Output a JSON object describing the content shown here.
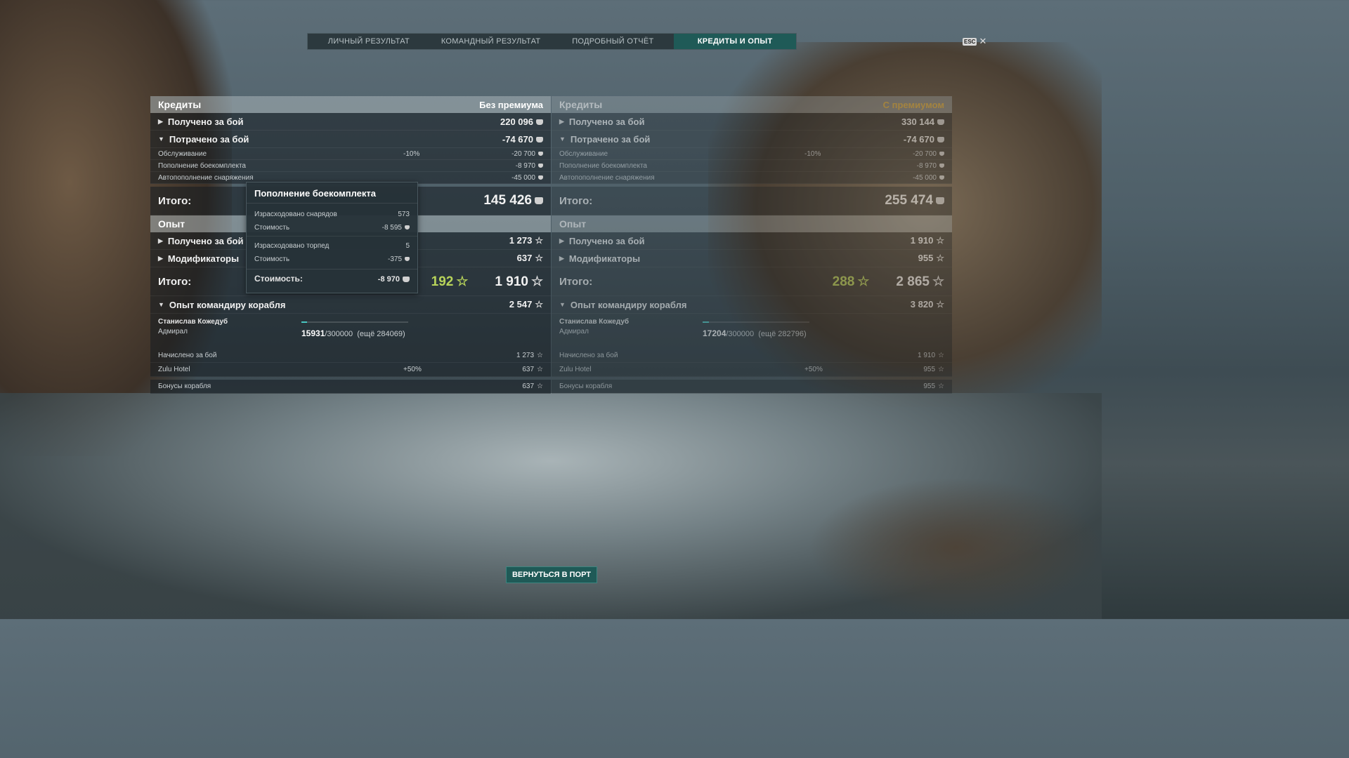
{
  "tabs": [
    "ЛИЧНЫЙ РЕЗУЛЬТАТ",
    "КОМАНДНЫЙ РЕЗУЛЬТАТ",
    "ПОДРОБНЫЙ ОТЧЁТ",
    "КРЕДИТЫ И ОПЫТ"
  ],
  "active_tab": "КРЕДИТЫ И ОПЫТ",
  "esc": {
    "key": "ESC",
    "close": "✕"
  },
  "left": {
    "credits_title": "Кредиты",
    "credits_sub": "Без премиума",
    "earned_label": "Получено за бой",
    "earned_value": "220 096",
    "spent_label": "Потрачено за бой",
    "spent_value": "-74 670",
    "service_label": "Обслуживание",
    "service_pct": "-10%",
    "service_value": "-20 700",
    "ammo_label": "Пополнение боекомплекта",
    "ammo_value": "-8 970",
    "auto_label": "Автопополнение снаряжения",
    "auto_value": "-45 000",
    "total_label": "Итого:",
    "total_value": "145 426",
    "xp_title": "Опыт",
    "xp_earned_label": "Получено за бой",
    "xp_earned_value": "1 273",
    "mods_label": "Модификаторы",
    "mods_value": "637",
    "xp_total_label": "Итого:",
    "xp_free": "192",
    "xp_total": "1 910",
    "cmd_label": "Опыт командиру корабля",
    "cmd_value": "2 547",
    "cmd_name": "Станислав Кожедуб",
    "cmd_rank": "Адмирал",
    "cmd_xp_current": "15931",
    "cmd_xp_max": "/300000",
    "cmd_xp_left": "(ещё 284069)",
    "cmd_progress": 0.053,
    "accrued_label": "Начислено за бой",
    "accrued_value": "1 273",
    "zulu_label": "Zulu Hotel",
    "zulu_pct": "+50%",
    "zulu_value": "637",
    "bonus_label": "Бонусы корабля",
    "bonus_value": "637"
  },
  "right": {
    "credits_title": "Кредиты",
    "credits_sub": "С премиумом",
    "earned_label": "Получено за бой",
    "earned_value": "330 144",
    "spent_label": "Потрачено за бой",
    "spent_value": "-74 670",
    "service_label": "Обслуживание",
    "service_pct": "-10%",
    "service_value": "-20 700",
    "ammo_label": "Пополнение боекомплекта",
    "ammo_value": "-8 970",
    "auto_label": "Автопополнение снаряжения",
    "auto_value": "-45 000",
    "total_label": "Итого:",
    "total_value": "255 474",
    "xp_title": "Опыт",
    "xp_earned_label": "Получено за бой",
    "xp_earned_value": "1 910",
    "mods_label": "Модификаторы",
    "mods_value": "955",
    "xp_total_label": "Итого:",
    "xp_free": "288",
    "xp_total": "2 865",
    "cmd_label": "Опыт командиру корабля",
    "cmd_value": "3 820",
    "cmd_name": "Станислав Кожедуб",
    "cmd_rank": "Адмирал",
    "cmd_xp_current": "17204",
    "cmd_xp_max": "/300000",
    "cmd_xp_left": "(ещё 282796)",
    "cmd_progress": 0.057,
    "accrued_label": "Начислено за бой",
    "accrued_value": "1 910",
    "zulu_label": "Zulu Hotel",
    "zulu_pct": "+50%",
    "zulu_value": "955",
    "bonus_label": "Бонусы корабля",
    "bonus_value": "955"
  },
  "tooltip": {
    "title": "Пополнение боекомплекта",
    "shells_label": "Израсходовано снарядов",
    "shells_value": "573",
    "shells_cost_label": "Стоимость",
    "shells_cost_value": "-8 595",
    "torps_label": "Израсходовано торпед",
    "torps_value": "5",
    "torps_cost_label": "Стоимость",
    "torps_cost_value": "-375",
    "total_label": "Стоимость:",
    "total_value": "-8 970"
  },
  "port_button": "ВЕРНУТЬСЯ В ПОРТ",
  "colors": {
    "accent": "#1f5a57",
    "premium": "#e0b040",
    "free_xp": "#b8d45a"
  }
}
